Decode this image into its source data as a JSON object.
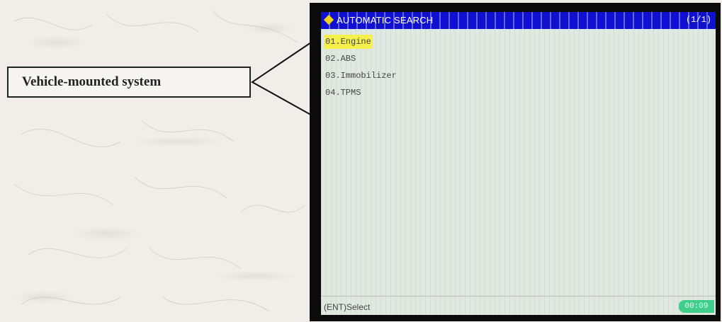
{
  "callout": {
    "label": "Vehicle-mounted system"
  },
  "screen": {
    "title": "AUTOMATIC SEARCH",
    "page_indicator": "(1/1)",
    "menu_items": [
      {
        "label": "01.Engine",
        "selected": true
      },
      {
        "label": "02.ABS",
        "selected": false
      },
      {
        "label": "03.Immobilizer",
        "selected": false
      },
      {
        "label": "04.TPMS",
        "selected": false
      }
    ],
    "hint": "(ENT)Select",
    "timer": "00:09"
  },
  "colors": {
    "title_bar": "#1010d0",
    "highlight": "#f5f04a",
    "timer_badge": "#3fcf8a",
    "screen_bg": "#e1e8e1"
  },
  "icons": {
    "title_icon": "yellow-diamond-icon"
  }
}
